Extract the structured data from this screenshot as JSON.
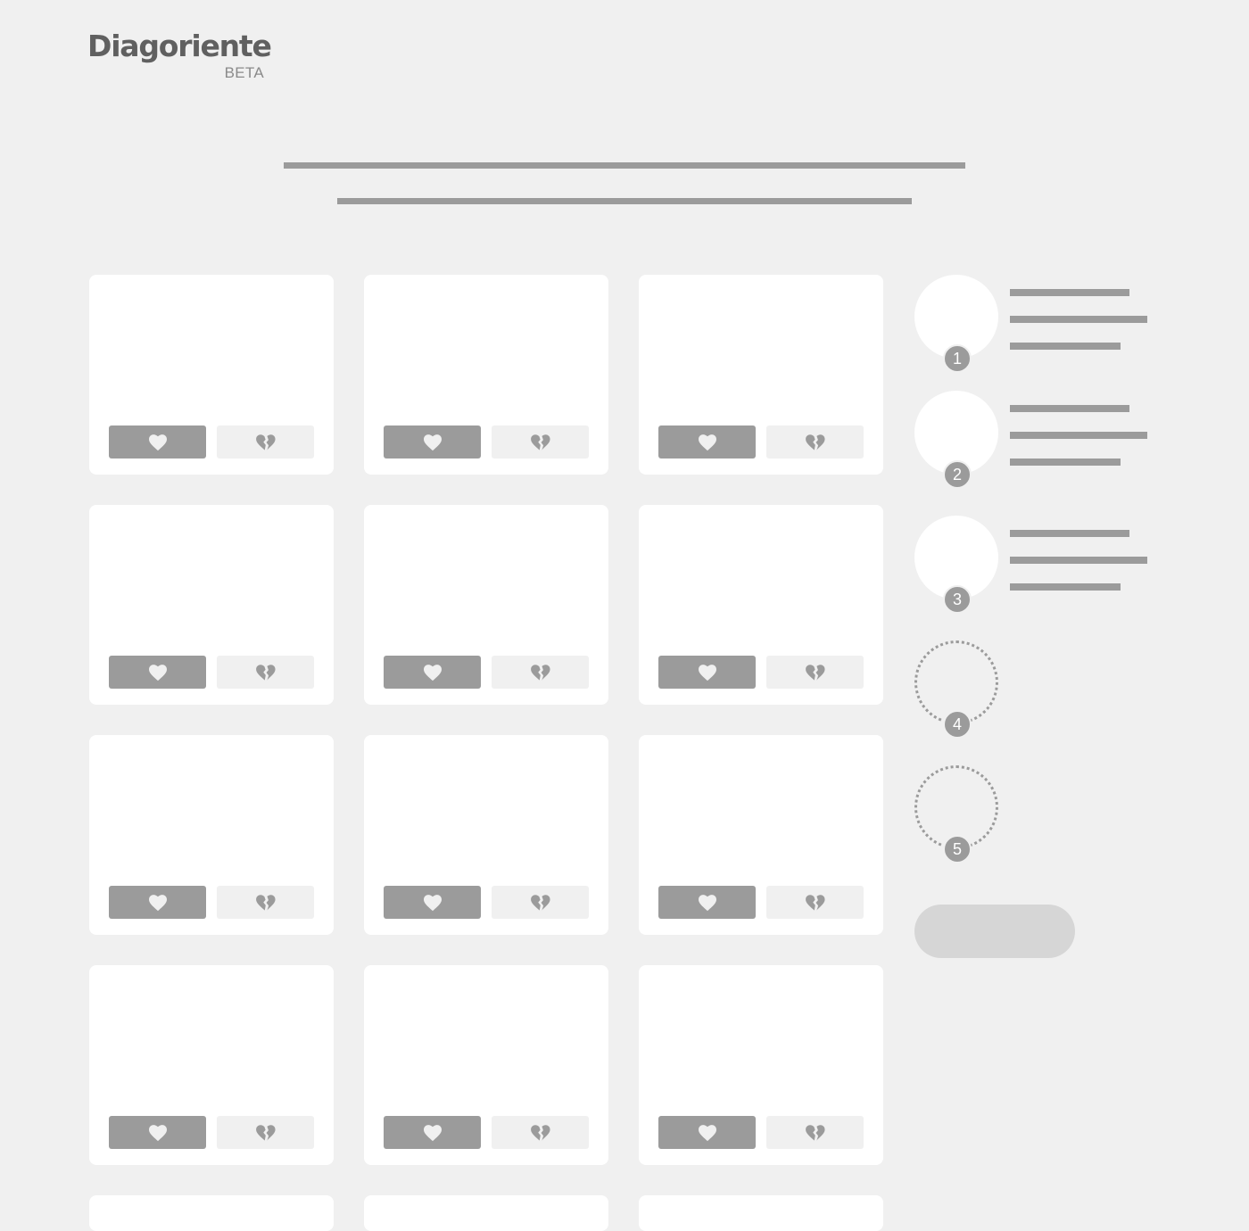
{
  "logo": {
    "wordmark": "Diagoriente",
    "badge": "BETA"
  },
  "colors": {
    "background": "#f0f0f0",
    "card": "#ffffff",
    "placeholder": "#9b9b9b",
    "pill": "#d6d6d6"
  },
  "cards": {
    "like_icon": "heart-icon",
    "dislike_icon": "broken-heart-icon",
    "full_rows": 4,
    "columns": 3,
    "partial_row_visible": true
  },
  "selection": {
    "slots": [
      {
        "number": "1",
        "state": "filled"
      },
      {
        "number": "2",
        "state": "filled"
      },
      {
        "number": "3",
        "state": "filled"
      },
      {
        "number": "4",
        "state": "empty"
      },
      {
        "number": "5",
        "state": "empty"
      }
    ]
  }
}
